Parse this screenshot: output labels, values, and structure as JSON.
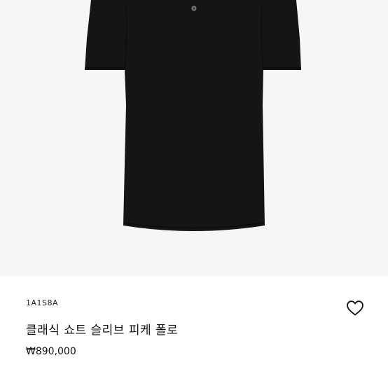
{
  "product": {
    "image_icon": "black-polo-shirt",
    "sku": "1A1S8A",
    "title": "클래식 쇼트 슬리브 피케 폴로",
    "price": "₩890,000",
    "wishlist_icon": "heart-outline-icon"
  },
  "colors": {
    "image_background": "#f6f6f6",
    "shirt": "#151515",
    "text": "#111111"
  }
}
